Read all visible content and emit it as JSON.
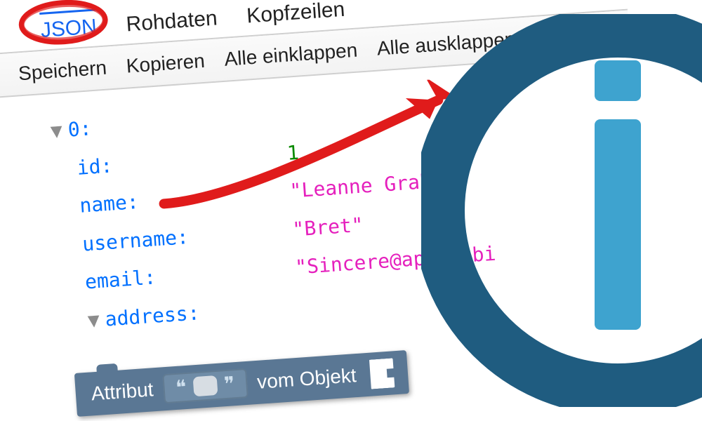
{
  "tabs": {
    "json": "JSON",
    "raw": "Rohdaten",
    "headers": "Kopfzeilen"
  },
  "toolbar": {
    "save": "Speichern",
    "copy": "Kopieren",
    "collapse_all": "Alle einklappen",
    "expand_all": "Alle ausklappen"
  },
  "tree": {
    "root_index": "0:",
    "keys": {
      "id": "id:",
      "name": "name:",
      "username": "username:",
      "email": "email:",
      "address": "address:"
    },
    "values": {
      "id": "1",
      "name": "\"Leanne Graham\"",
      "username": "\"Bret\"",
      "email": "\"Sincere@april.bi"
    }
  },
  "block": {
    "attr": "Attribut",
    "of_object": "vom Objekt"
  }
}
